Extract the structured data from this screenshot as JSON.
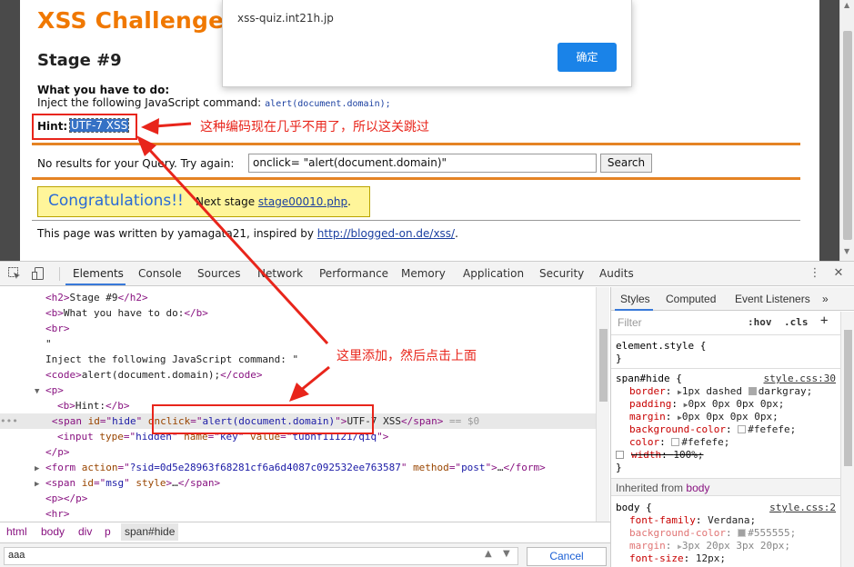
{
  "page": {
    "site_title": "XSS Challenges",
    "stage": "Stage #9",
    "todo_heading": "What you have to do:",
    "todo_text": "Inject the following JavaScript command:",
    "todo_code": "alert(document.domain);",
    "hint_label": "Hint:",
    "hint_value": "UTF-7 XSS",
    "annotation_hint": "这种编码现在几乎不用了，所以这关跳过",
    "query_label": "No results for your Query. Try again:",
    "query_value": "onclick= \"alert(document.domain)\"",
    "search_label": "Search",
    "congrats_big": "Congratulations!!",
    "congrats_prefix": "Next stage",
    "congrats_link": "stage00010.php",
    "congrats_suffix": ".",
    "footer_prefix": "This page was written by yamagata21, inspired by",
    "footer_link": "http://blogged-on.de/xss/",
    "footer_suffix": "."
  },
  "dialog": {
    "message": "xss-quiz.int21h.jp",
    "ok_label": "确定"
  },
  "devtools": {
    "tabs": [
      "Elements",
      "Console",
      "Sources",
      "Network",
      "Performance",
      "Memory",
      "Application",
      "Security",
      "Audits"
    ],
    "active_tab": "Elements",
    "elements": {
      "h2": "Stage #9",
      "b_todo": "What you have to do:",
      "quote": "\"",
      "inject_text": "Inject the following JavaScript command: \"",
      "code_text": "alert(document.domain);",
      "hint_b": "Hint:",
      "span_id": "hide",
      "span_onclick": "alert(document.domain)",
      "span_text": "UTF-7 XSS",
      "eq": "== $0",
      "input_type": "hidden",
      "input_name": "key",
      "input_value": "tubhf11121/qiq",
      "form_action": "?sid=0d5e28963f68281cf6a6d4087c092532ee763587",
      "form_method": "post",
      "msg_id": "msg",
      "ellipsis": "…",
      "dots": "•••"
    },
    "annotation_edit": "这里添加，然后点击上面",
    "breadcrumbs": [
      "html",
      "body",
      "div",
      "p",
      "span#hide"
    ],
    "find_value": "aaa",
    "find_cancel": "Cancel",
    "styles": {
      "tabs": [
        "Styles",
        "Computed",
        "Event Listeners"
      ],
      "filter_placeholder": "Filter",
      "hov": ":hov",
      "cls": ".cls",
      "plus": "+",
      "element_style": "element.style {",
      "close": "}",
      "rule1_selector": "span#hide {",
      "rule1_source": "style.css:30",
      "rule1_props": [
        {
          "name": "border",
          "value": "1px dashed",
          "swatch": "#a9a9a9",
          "after": "darkgray;"
        },
        {
          "name": "padding",
          "value": "0px 0px 0px 0px;"
        },
        {
          "name": "margin",
          "value": "0px 0px 0px 0px;"
        },
        {
          "name": "background-color",
          "value": "",
          "swatch": "#fefefe",
          "after": "#fefefe;"
        },
        {
          "name": "color",
          "value": "",
          "swatch": "#fefefe",
          "after": "#fefefe;"
        },
        {
          "name": "width",
          "value": "100%;",
          "struck": true
        }
      ],
      "inherited_label": "Inherited from",
      "inherited_from": "body",
      "rule2_selector": "body {",
      "rule2_source": "style.css:2",
      "rule2_props": [
        {
          "name": "font-family",
          "value": "Verdana;"
        },
        {
          "name": "background-color",
          "value": "",
          "swatch": "#555555",
          "after": "#555555;"
        },
        {
          "name": "margin",
          "value": "3px 20px 3px 20px;"
        },
        {
          "name": "font-size",
          "value": "12px;"
        }
      ]
    }
  },
  "colors": {
    "accent_red": "#e8251b",
    "site_orange": "#f07800",
    "devtools_blue": "#3879d9"
  }
}
